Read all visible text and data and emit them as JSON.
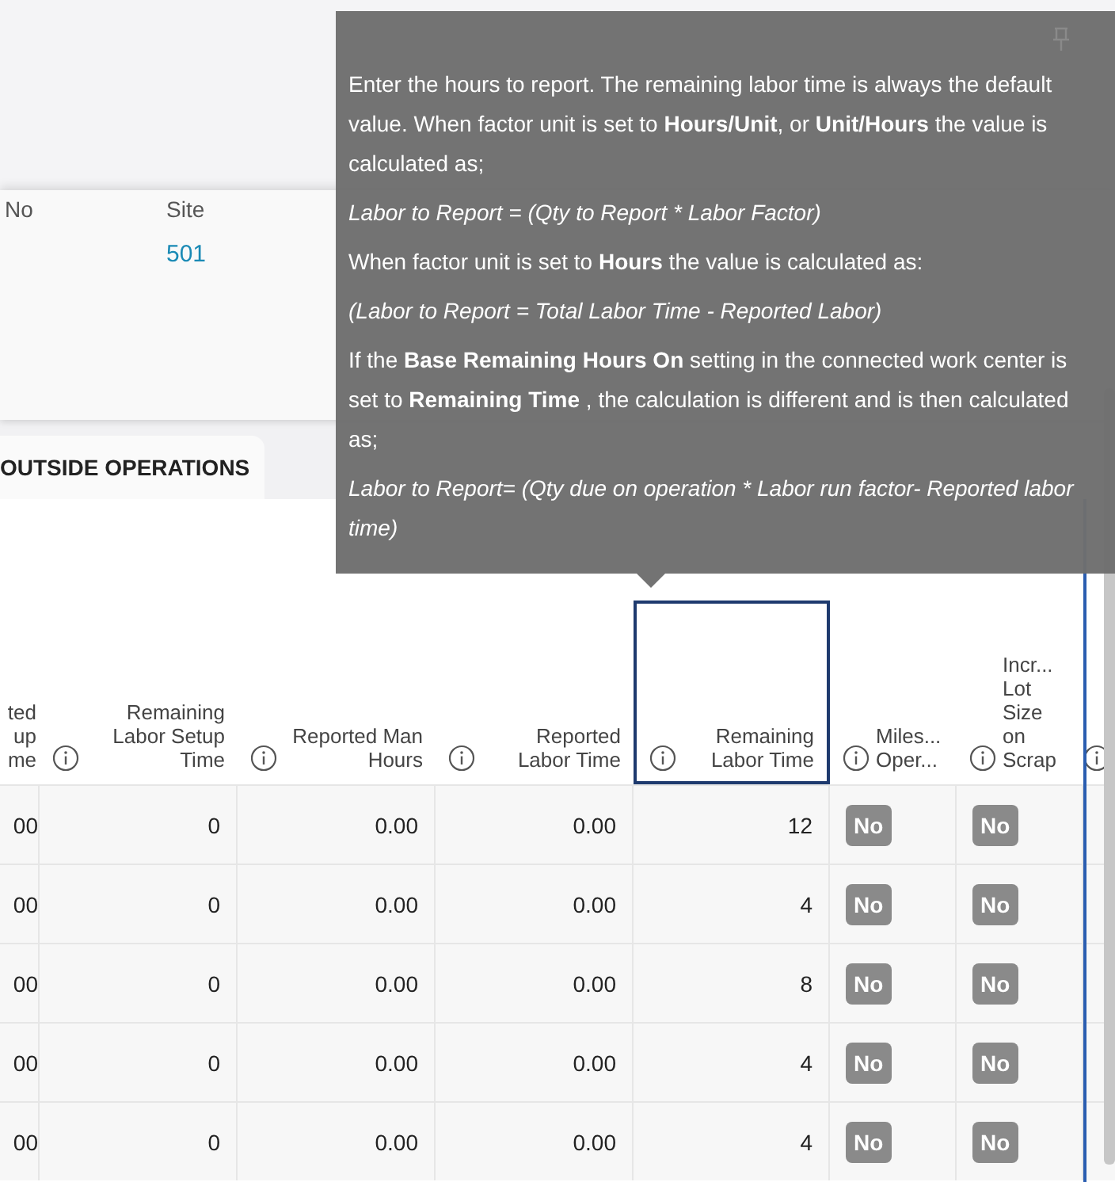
{
  "record": {
    "fields": [
      {
        "label": "No"
      },
      {
        "label": "Site",
        "value": "501"
      }
    ]
  },
  "tabs": [
    {
      "label": "OUTSIDE OPERATIONS",
      "selected": true
    }
  ],
  "table": {
    "columns": [
      {
        "label": "ted\nup\nme",
        "kind": "number",
        "info": false,
        "focused": false
      },
      {
        "label": "Remaining\nLabor Setup\nTime",
        "kind": "number",
        "info": true,
        "focused": false
      },
      {
        "label": "Reported Man\nHours",
        "kind": "number",
        "info": true,
        "focused": false
      },
      {
        "label": "Reported\nLabor Time",
        "kind": "number",
        "info": true,
        "focused": false
      },
      {
        "label": "Remaining\nLabor Time",
        "kind": "number",
        "info": true,
        "focused": true
      },
      {
        "label": "Miles...\nOper...",
        "kind": "flag",
        "info": true,
        "focused": false
      },
      {
        "label": "Incr...\nLot\nSize\non\nScrap",
        "kind": "flag",
        "info": true,
        "focused": false
      }
    ],
    "rows": [
      [
        "00",
        "0",
        "0.00",
        "0.00",
        "12",
        "No",
        "No"
      ],
      [
        "00",
        "0",
        "0.00",
        "0.00",
        "4",
        "No",
        "No"
      ],
      [
        "00",
        "0",
        "0.00",
        "0.00",
        "8",
        "No",
        "No"
      ],
      [
        "00",
        "0",
        "0.00",
        "0.00",
        "4",
        "No",
        "No"
      ],
      [
        "00",
        "0",
        "0.00",
        "0.00",
        "4",
        "No",
        "No"
      ]
    ]
  },
  "tooltip": {
    "paragraphs": [
      {
        "kind": "text",
        "text": "Enter the hours to report. The remaining labor time is always the default value. When factor unit is set to **Hours/Unit**, or **Unit/Hours** the value is calculated as;"
      },
      {
        "kind": "formula",
        "text": "Labor to Report = (Qty to Report * Labor Factor)"
      },
      {
        "kind": "text",
        "text": "When factor unit is set to **Hours** the value is calculated as:"
      },
      {
        "kind": "formula",
        "text": "(Labor to Report = Total Labor Time - Reported Labor)"
      },
      {
        "kind": "text",
        "text": "If the **Base Remaining Hours On** setting in the connected work center is set to **Remaining Time** , the calculation is different and is then calculated as;"
      },
      {
        "kind": "formula",
        "text": "Labor to Report= (Qty due on operation * Labor run factor- Reported labor time)"
      }
    ]
  }
}
